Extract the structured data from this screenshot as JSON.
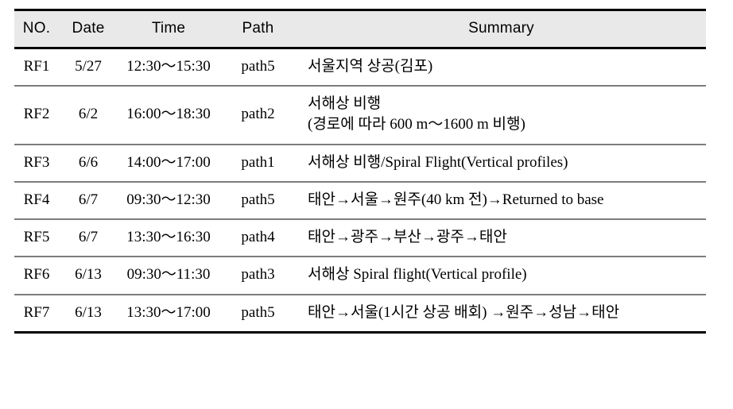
{
  "table": {
    "columns": [
      {
        "key": "no",
        "label": "NO."
      },
      {
        "key": "date",
        "label": "Date"
      },
      {
        "key": "time",
        "label": "Time"
      },
      {
        "key": "path",
        "label": "Path"
      },
      {
        "key": "summary",
        "label": "Summary"
      }
    ],
    "rows": [
      {
        "no": "RF1",
        "date": "5/27",
        "time": "12:30～15:30",
        "path": "path5",
        "summary_lines": [
          "서울지역 상공(김포)"
        ]
      },
      {
        "no": "RF2",
        "date": "6/2",
        "time": "16:00～18:30",
        "path": "path2",
        "summary_lines": [
          "서해상 비행",
          "(경로에 따라 600 m～1600 m 비행)"
        ]
      },
      {
        "no": "RF3",
        "date": "6/6",
        "time": "14:00～17:00",
        "path": "path1",
        "summary_lines": [
          "서해상 비행/Spiral Flight(Vertical profiles)"
        ]
      },
      {
        "no": "RF4",
        "date": "6/7",
        "time": "09:30～12:30",
        "path": "path5",
        "summary_lines": [
          "태안→서울→원주(40 km 전)→Returned to base"
        ]
      },
      {
        "no": "RF5",
        "date": "6/7",
        "time": "13:30～16:30",
        "path": "path4",
        "summary_lines": [
          "태안→광주→부산→광주→태안"
        ]
      },
      {
        "no": "RF6",
        "date": "6/13",
        "time": "09:30～11:30",
        "path": "path3",
        "summary_lines": [
          "서해상 Spiral flight(Vertical profile)"
        ]
      },
      {
        "no": "RF7",
        "date": "6/13",
        "time": "13:30～17:00",
        "path": "path5",
        "summary_lines": [
          "태안→서울(1시간 상공 배회) →원주→성남→태안"
        ]
      }
    ]
  },
  "style": {
    "header_bg": "#e9e9e9",
    "rule_heavy": "#000000",
    "rule_light": "#7d7d7d",
    "text": "#000000"
  }
}
